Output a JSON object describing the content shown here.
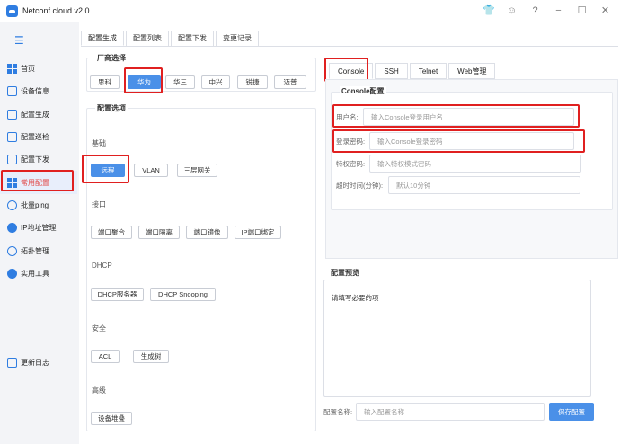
{
  "app": {
    "title": "Netconf.cloud v2.0"
  },
  "window_controls": [
    "shirt-icon",
    "user-icon",
    "help-icon",
    "minimize-icon",
    "maximize-icon",
    "close-icon"
  ],
  "sidebar": {
    "items": [
      {
        "label": "首页",
        "icon": "grid-icon"
      },
      {
        "label": "设备信息",
        "icon": "device-info-icon"
      },
      {
        "label": "配置生成",
        "icon": "config-gen-icon"
      },
      {
        "label": "配置巡检",
        "icon": "inspect-icon"
      },
      {
        "label": "配置下发",
        "icon": "deploy-icon"
      },
      {
        "label": "常用配置",
        "icon": "common-config-icon"
      },
      {
        "label": "批量ping",
        "icon": "ping-icon"
      },
      {
        "label": "IP地址管理",
        "icon": "ip-icon"
      },
      {
        "label": "拓扑管理",
        "icon": "topology-icon"
      },
      {
        "label": "实用工具",
        "icon": "tools-icon"
      }
    ],
    "active_index": 5,
    "changelog_label": "更新日志"
  },
  "tabs": [
    "配置生成",
    "配置列表",
    "配置下发",
    "变更记录"
  ],
  "vendor": {
    "title": "厂商选择",
    "options": [
      "思科",
      "华为",
      "华三",
      "中兴",
      "锐捷",
      "迈普"
    ],
    "selected": "华为"
  },
  "options": {
    "title": "配置选项",
    "groups": [
      {
        "label": "基础",
        "buttons": [
          "远程",
          "VLAN",
          "三层网关"
        ]
      },
      {
        "label": "接口",
        "buttons": [
          "端口聚合",
          "端口隔离",
          "端口镜像",
          "IP端口绑定"
        ]
      },
      {
        "label": "DHCP",
        "buttons": [
          "DHCP服务器",
          "DHCP Snooping"
        ]
      },
      {
        "label": "安全",
        "buttons": [
          "ACL",
          "生成树"
        ]
      },
      {
        "label": "高级",
        "buttons": [
          "设备堆叠"
        ]
      }
    ],
    "selected": "远程"
  },
  "right_tabs": [
    "Console",
    "SSH",
    "Telnet",
    "Web管理"
  ],
  "console": {
    "title": "Console配置",
    "fields": [
      {
        "label": "用户名:",
        "placeholder": "输入Console登录用户名"
      },
      {
        "label": "登录密码:",
        "placeholder": "输入Console登录密码"
      },
      {
        "label": "特权密码:",
        "placeholder": "输入特权模式密码"
      },
      {
        "label": "超时时间(分钟):",
        "placeholder": "默认10分钟"
      }
    ]
  },
  "preview": {
    "title": "配置预览",
    "content": "请填写必要的项",
    "name_label": "配置名称:",
    "name_placeholder": "输入配置名称",
    "save_label": "保存配置"
  },
  "colors": {
    "accent": "#4a90e8",
    "highlight": "#e02020",
    "active_nav": "#e24a4a"
  }
}
